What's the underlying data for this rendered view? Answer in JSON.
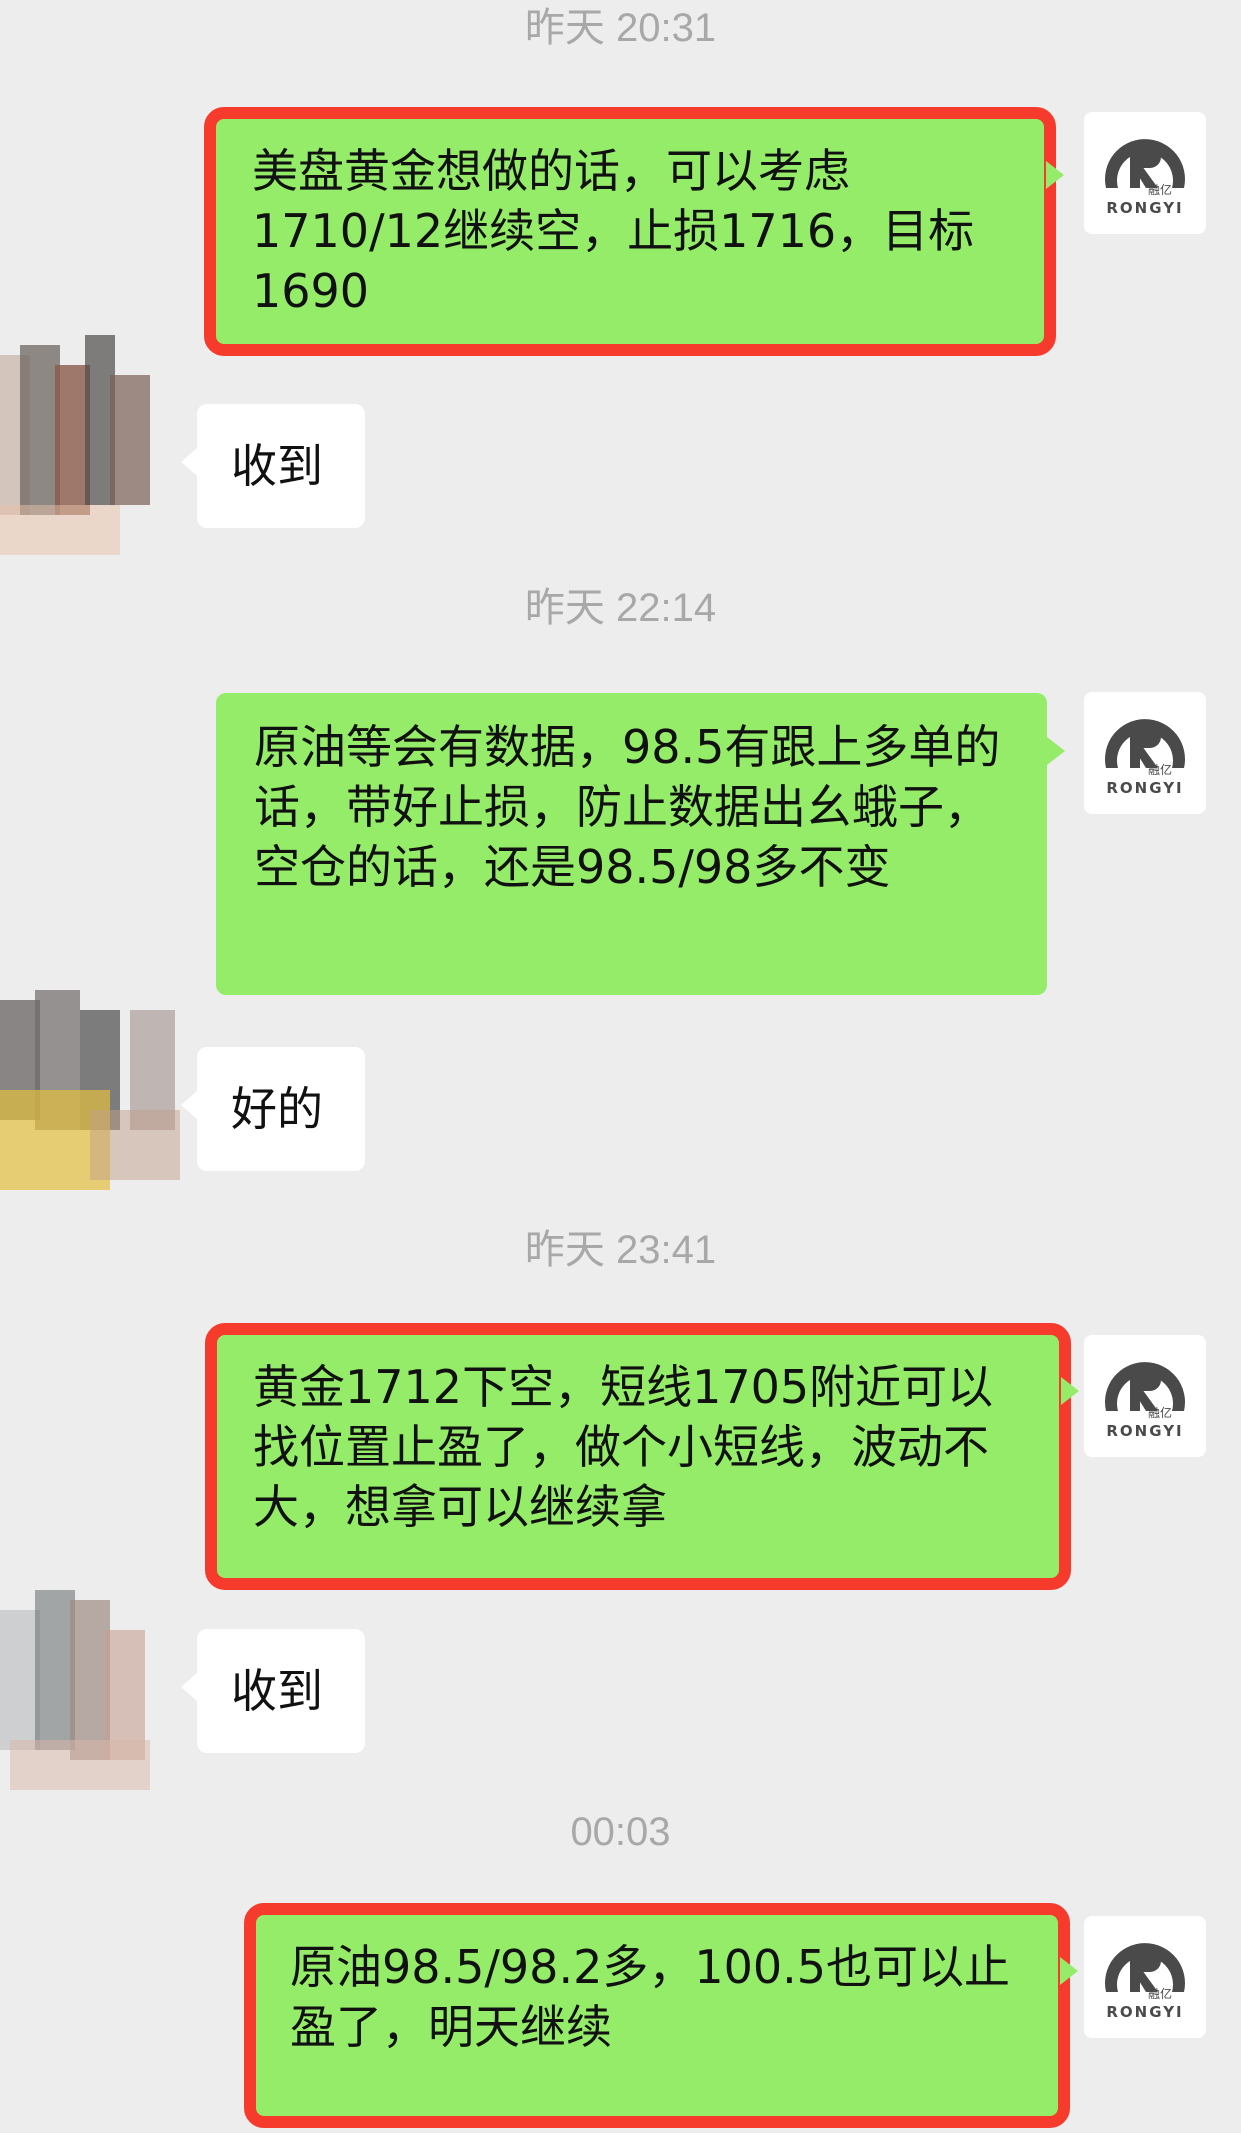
{
  "colors": {
    "background": "#ededed",
    "own_bubble": "#95ec69",
    "other_bubble": "#ffffff",
    "highlight_box": "#f63a2c",
    "logo_dark": "#4a4a4a"
  },
  "logo": {
    "cn": "融亿",
    "en": "RONGYI"
  },
  "messages": [
    {
      "timestamp": "昨天 20:31",
      "own": "美盘黄金想做的话，可以考虑1710/12继续空，止损1716，目标1690",
      "reply": "收到"
    },
    {
      "timestamp": "昨天 22:14",
      "own": "原油等会有数据，98.5有跟上多单的话，带好止损，防止数据出幺蛾子，空仓的话，还是98.5/98多不变",
      "reply": "好的"
    },
    {
      "timestamp": "昨天 23:41",
      "own": "黄金1712下空，短线1705附近可以找位置止盈了，做个小短线，波动不大，想拿可以继续拿",
      "reply": "收到"
    },
    {
      "timestamp": "00:03",
      "own": "原油98.5/98.2多，100.5也可以止盈了，明天继续"
    }
  ]
}
